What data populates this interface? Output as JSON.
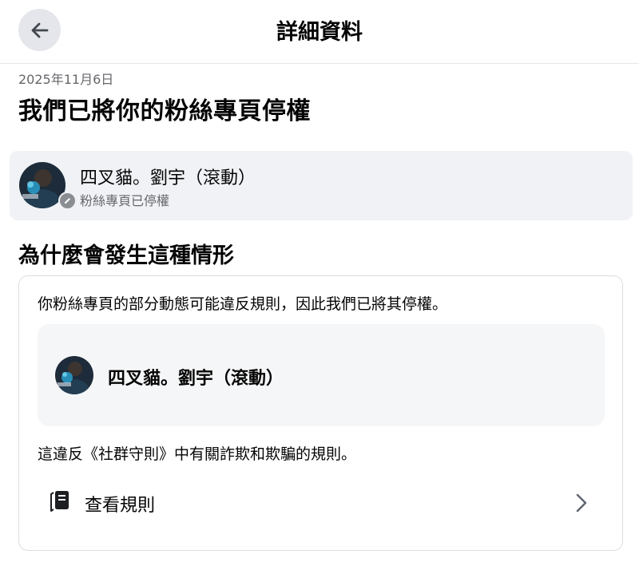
{
  "header": {
    "title": "詳細資料",
    "back_icon": "arrow-left-icon"
  },
  "notice": {
    "date": "2025年11月6日",
    "headline": "我們已將你的粉絲專頁停權"
  },
  "page_card": {
    "name": "四叉貓。劉宇（滾動）",
    "status": "粉絲專頁已停權",
    "badge_icon": "pencil-icon"
  },
  "reason": {
    "section_title": "為什麼會發生這種情形",
    "text": "你粉絲專頁的部分動態可能違反規則，因此我們已將其停權。",
    "inner_page_name": "四叉貓。劉宇（滾動）",
    "violation": "這違反《社群守則》中有關詐欺和欺騙的規則。",
    "rules_link": "查看規則",
    "rules_icon": "book-icon",
    "chevron_icon": "chevron-right-icon"
  },
  "colors": {
    "secondary_text": "#65676b",
    "card_bg": "#f0f2f5",
    "border": "#dadde1"
  }
}
